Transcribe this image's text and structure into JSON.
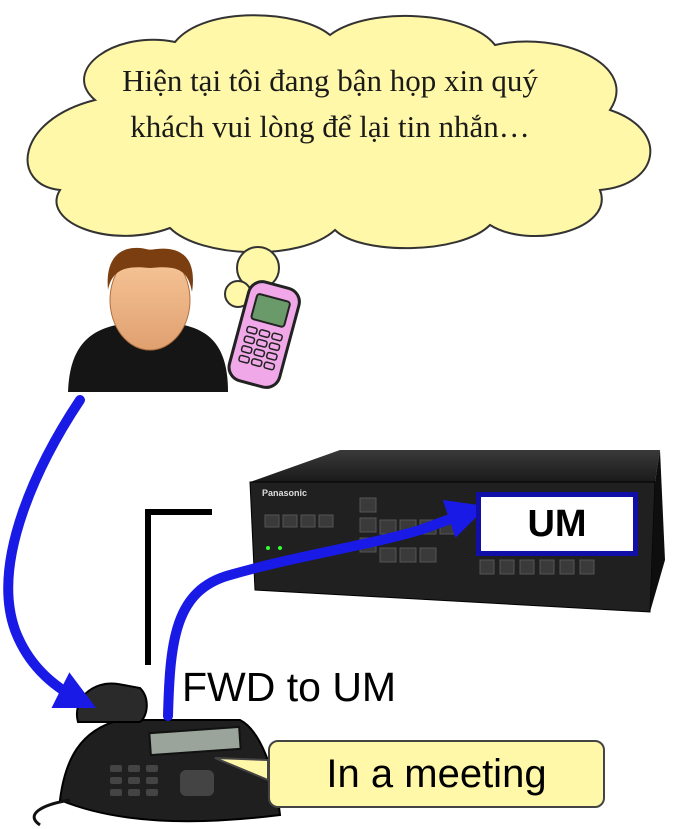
{
  "cloud": {
    "message": "Hiện tại tôi đang bận họp xin quý khách vui lòng để lại tin nhắn…"
  },
  "pbx": {
    "brand": "Panasonic",
    "um_label": "UM"
  },
  "phone": {
    "forward_label": "FWD to UM",
    "status_label": "In a meeting"
  },
  "colors": {
    "cloud_fill": "#fff8a8",
    "arrow": "#1a1ae6",
    "um_border": "#1010a8",
    "mobile_pink": "#f0a8e8"
  }
}
